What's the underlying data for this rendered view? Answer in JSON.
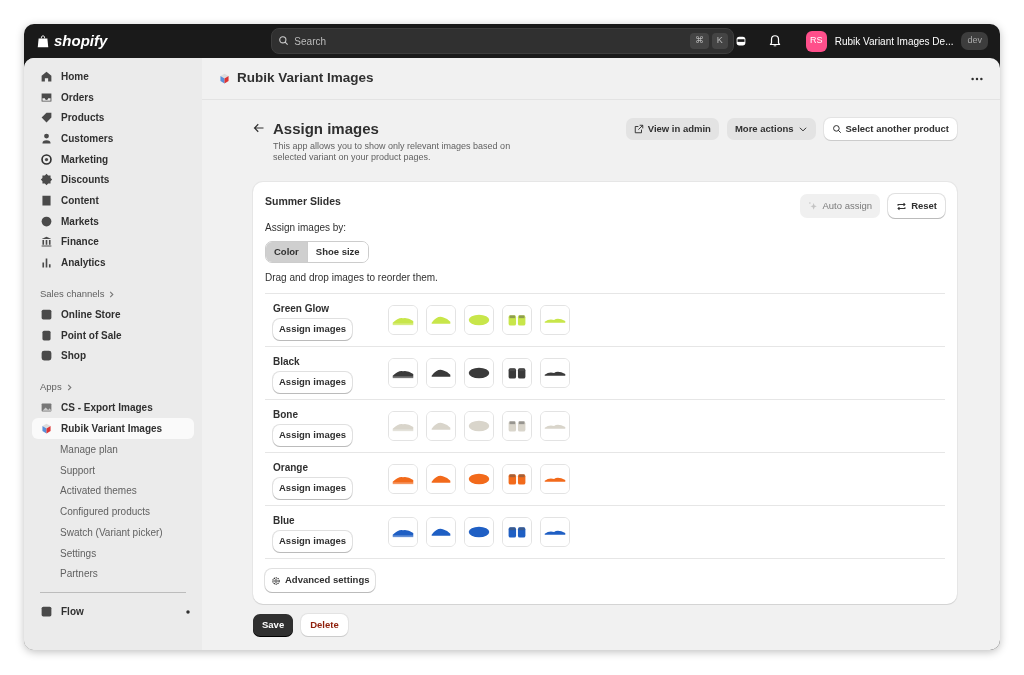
{
  "topbar": {
    "logo": "shopify",
    "search": {
      "placeholder": "Search"
    },
    "shortcut_keys": [
      "⌘",
      "K"
    ],
    "store": {
      "initials": "RS",
      "name": "Rubik Variant Images De...",
      "badge": "dev"
    }
  },
  "sidebar": {
    "items": [
      {
        "label": "Home",
        "selected": false
      },
      {
        "label": "Orders",
        "selected": false
      },
      {
        "label": "Products",
        "selected": false
      },
      {
        "label": "Customers",
        "selected": false
      },
      {
        "label": "Marketing",
        "selected": false
      },
      {
        "label": "Discounts",
        "selected": false
      },
      {
        "label": "Content",
        "selected": false
      },
      {
        "label": "Markets",
        "selected": false
      },
      {
        "label": "Finance",
        "selected": false
      },
      {
        "label": "Analytics",
        "selected": false
      }
    ],
    "sections": [
      {
        "title": "Sales channels",
        "items": [
          {
            "label": "Online Store",
            "selected": false
          },
          {
            "label": "Point of Sale",
            "selected": false
          },
          {
            "label": "Shop",
            "selected": false
          }
        ]
      },
      {
        "title": "Apps",
        "items": [
          {
            "label": "CS - Export Images",
            "selected": false
          },
          {
            "label": "Rubik Variant Images",
            "selected": true,
            "children": [
              {
                "label": "Manage plan"
              },
              {
                "label": "Support"
              },
              {
                "label": "Activated themes"
              },
              {
                "label": "Configured products"
              },
              {
                "label": "Swatch (Variant picker)"
              },
              {
                "label": "Settings"
              },
              {
                "label": "Partners"
              }
            ]
          }
        ]
      }
    ],
    "footer_item": {
      "label": "Flow"
    }
  },
  "app_header": {
    "title": "Rubik Variant Images"
  },
  "page": {
    "title": "Assign images",
    "description": "This app allows you to show only relevant images based on selected variant on your product pages.",
    "actions": [
      {
        "label": "View in admin",
        "kind": "gray"
      },
      {
        "label": "More actions",
        "kind": "gray"
      },
      {
        "label": "Select another product",
        "kind": "white"
      }
    ]
  },
  "card": {
    "product": "Summer Slides",
    "auto_assign": {
      "label": "Auto assign",
      "disabled": true
    },
    "reset": "Reset",
    "assign_by_label": "Assign images by:",
    "options": [
      {
        "label": "Color",
        "selected": true
      },
      {
        "label": "Shoe size",
        "selected": false
      }
    ],
    "hint": "Drag and drop images to reorder them.",
    "variants": [
      {
        "name": "Green Glow",
        "color": "#c8e64a",
        "button": "Assign images"
      },
      {
        "name": "Black",
        "color": "#3a3a3a",
        "button": "Assign images"
      },
      {
        "name": "Bone",
        "color": "#d9d5cb",
        "button": "Assign images"
      },
      {
        "name": "Orange",
        "color": "#f26a1b",
        "button": "Assign images"
      },
      {
        "name": "Blue",
        "color": "#1f5fc4",
        "button": "Assign images"
      }
    ],
    "advanced": "Advanced settings"
  },
  "footer_buttons": [
    {
      "label": "Save",
      "kind": "primary"
    },
    {
      "label": "Delete",
      "kind": "danger"
    }
  ]
}
